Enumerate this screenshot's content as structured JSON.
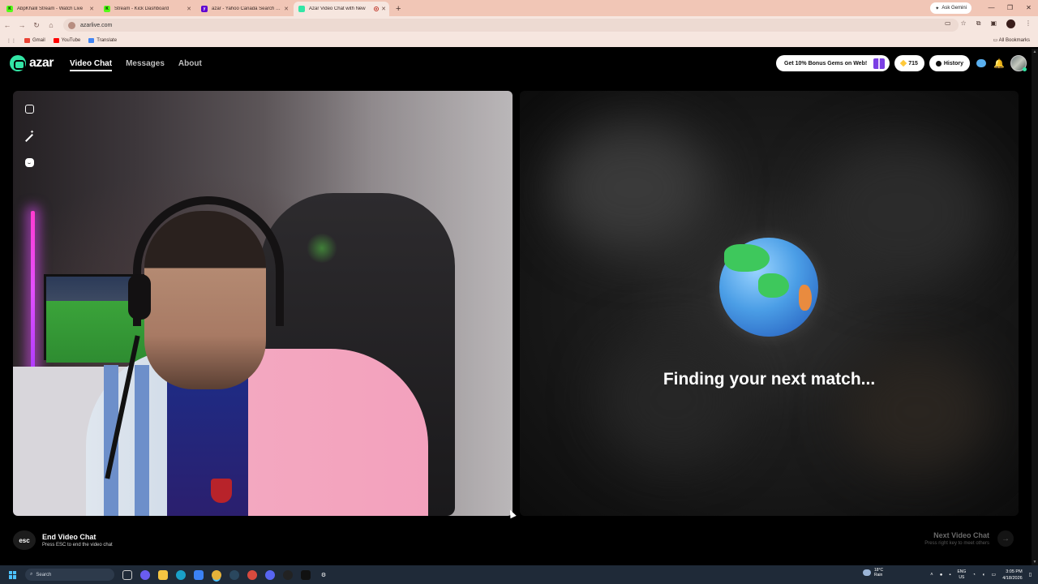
{
  "browser": {
    "tabs": [
      {
        "title": "AbpKhalil Stream - Watch Live",
        "favicon_color": "#53fc18",
        "active": false
      },
      {
        "title": "Stream - Kick Dashboard",
        "favicon_color": "#53fc18",
        "active": false
      },
      {
        "title": "azar - Yahoo Canada Search Re",
        "favicon_color": "#6001d2",
        "active": false
      },
      {
        "title": "Azar Video Chat with New",
        "favicon_color": "#33e6a6",
        "active": true
      }
    ],
    "new_tab_icon": "plus-icon",
    "ask_gemini": "Ask Gemini",
    "url": "azarlive.com",
    "bookmarks": [
      {
        "label": "Gmail",
        "color": "#ea4335"
      },
      {
        "label": "YouTube",
        "color": "#ff0000"
      },
      {
        "label": "Translate",
        "color": "#4285f4"
      }
    ],
    "all_bookmarks": "All Bookmarks"
  },
  "nav": {
    "logo": "azar",
    "links": [
      "Video Chat",
      "Messages",
      "About"
    ],
    "active_link": "Video Chat",
    "promo": "Get 10% Bonus Gems on Web!",
    "gems": "715",
    "history": "History"
  },
  "match": {
    "status": "Finding your next match..."
  },
  "controls": {
    "esc_key": "esc",
    "end_title": "End Video Chat",
    "end_sub": "Press ESC to end the video chat",
    "next_title": "Next Video Chat",
    "next_sub": "Press right key to meet others",
    "next_arrow": "→"
  },
  "taskbar": {
    "search_placeholder": "Search",
    "weather_temp": "18°C",
    "weather_desc": "Rain",
    "lang_top": "ENG",
    "lang_bottom": "US",
    "time": "3:05 PM",
    "date": "4/18/2026"
  }
}
